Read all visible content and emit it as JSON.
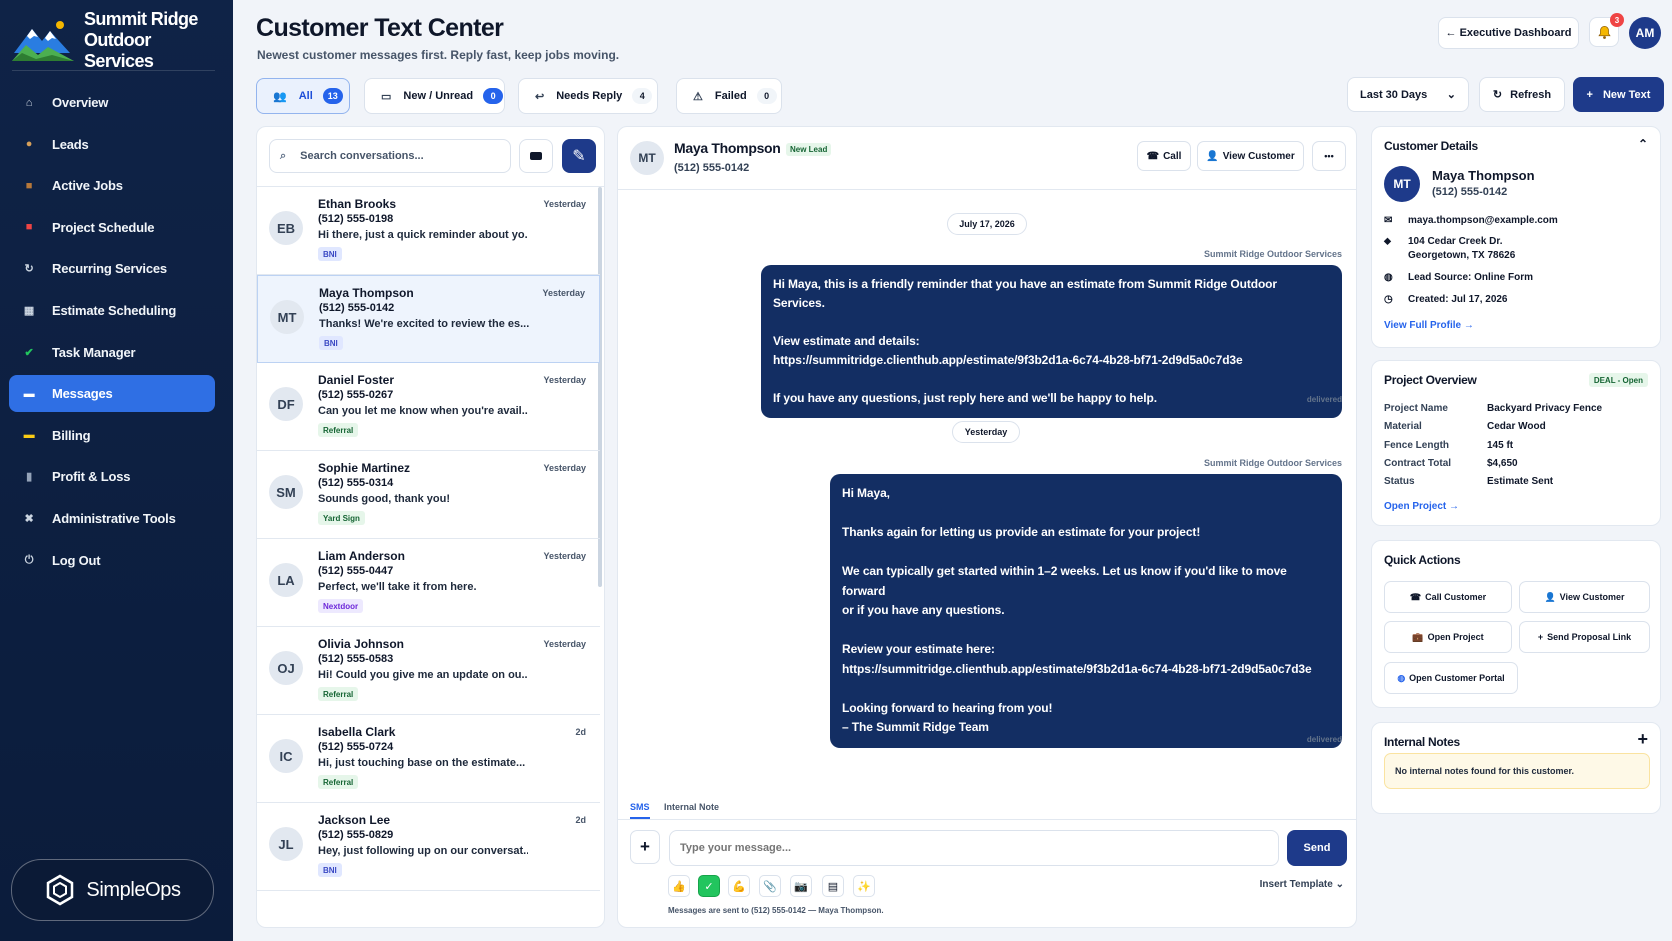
{
  "app": {
    "brand_line1": "Summit Ridge",
    "brand_line2": "Outdoor Services",
    "product": "SimpleOps",
    "accent": "#2f6fe4",
    "navy": "#132e63"
  },
  "sidebar": {
    "items": [
      {
        "label": "Overview",
        "icon": "home-icon"
      },
      {
        "label": "Leads",
        "icon": "users-icon"
      },
      {
        "label": "Active Jobs",
        "icon": "briefcase-icon"
      },
      {
        "label": "Project Schedule",
        "icon": "calendar-icon"
      },
      {
        "label": "Recurring Services",
        "icon": "refresh-icon"
      },
      {
        "label": "Estimate Scheduling",
        "icon": "calculator-icon"
      },
      {
        "label": "Task Manager",
        "icon": "check-icon"
      },
      {
        "label": "Messages",
        "icon": "message-icon",
        "active": true
      },
      {
        "label": "Billing",
        "icon": "card-icon"
      },
      {
        "label": "Profit & Loss",
        "icon": "chart-icon"
      },
      {
        "label": "Administrative Tools",
        "icon": "tools-icon"
      },
      {
        "label": "Log Out",
        "icon": "logout-icon"
      }
    ]
  },
  "header": {
    "title": "Customer Text Center",
    "subtitle": "Newest customer messages first. Reply fast, keep jobs moving.",
    "exec_dashboard": "← Executive Dashboard",
    "notif_count": "3",
    "avatar": "AM",
    "range": "Last 30 Days",
    "refresh": "Refresh",
    "new_text": "New Text"
  },
  "filters": [
    {
      "label": "All",
      "count": "13"
    },
    {
      "label": "New / Unread",
      "count": "0"
    },
    {
      "label": "Needs Reply",
      "count": "4"
    },
    {
      "label": "Failed",
      "count": "0"
    }
  ],
  "search": {
    "placeholder": "Search conversations..."
  },
  "conversations": [
    {
      "initials": "EB",
      "name": "Ethan Brooks",
      "phone": "(512) 555-0198",
      "preview": "Hi there, just a quick reminder about yo...",
      "date": "Yesterday",
      "tag": "BNI"
    },
    {
      "initials": "MT",
      "name": "Maya Thompson",
      "phone": "(512) 555-0142",
      "preview": "Thanks! We're excited to review the es...",
      "date": "Yesterday",
      "tag": "BNI"
    },
    {
      "initials": "DF",
      "name": "Daniel Foster",
      "phone": "(512) 555-0267",
      "preview": "Can you let me know when you're avail...",
      "date": "Yesterday",
      "tag": "Referral"
    },
    {
      "initials": "SM",
      "name": "Sophie Martinez",
      "phone": "(512) 555-0314",
      "preview": "Sounds good, thank you!",
      "date": "Yesterday",
      "tag": "Yard Sign"
    },
    {
      "initials": "LA",
      "name": "Liam Anderson",
      "phone": "(512) 555-0447",
      "preview": "Perfect, we'll take it from here.",
      "date": "Yesterday",
      "tag": "Nextdoor"
    },
    {
      "initials": "OJ",
      "name": "Olivia Johnson",
      "phone": "(512) 555-0583",
      "preview": "Hi! Could you give me an update on ou...",
      "date": "Yesterday",
      "tag": "Referral"
    },
    {
      "initials": "IC",
      "name": "Isabella Clark",
      "phone": "(512) 555-0724",
      "preview": "Hi, just touching base on the estimate...",
      "date": "2d",
      "tag": "Referral"
    },
    {
      "initials": "JL",
      "name": "Jackson Lee",
      "phone": "(512) 555-0829",
      "preview": "Hey, just following up on our conversat...",
      "date": "2d",
      "tag": "BNI"
    }
  ],
  "chat": {
    "initials": "MT",
    "name": "Maya Thompson",
    "badge": "New Lead",
    "phone": "(512) 555-0142",
    "call": "Call",
    "view_customer": "View Customer",
    "more": "•••",
    "date1": "July 17, 2026",
    "sender": "Summit Ridge Outdoor Services",
    "msg1": "Hi Maya, this is a friendly reminder that you have an estimate from Summit Ridge Outdoor Services.\n\nView estimate and details:\nhttps://summitridge.clienthub.app/estimate/9f3b2d1a-6c74-4b28-bf71-2d9d5a0c7d3e\n\nIf you have any questions, just reply here and we'll be happy to help.",
    "status1": "delivered",
    "date2": "Yesterday",
    "msg2": "Hi Maya,\n\nThanks again for letting us provide an estimate for your project!\n\nWe can typically get started within 1–2 weeks. Let us know if you'd like to move forward\nor if you have any questions.\n\nReview your estimate here:\nhttps://summitridge.clienthub.app/estimate/9f3b2d1a-6c74-4b28-bf71-2d9d5a0c7d3e\n\nLooking forward to hearing from you!\n– The Summit Ridge Team",
    "status2": "delivered",
    "tab_sms": "SMS",
    "tab_note": "Internal Note",
    "input_placeholder": "Type your message...",
    "send": "Send",
    "insert_template": "Insert Template",
    "footnote": "Messages are sent to (512) 555-0142 — Maya Thompson."
  },
  "customer": {
    "title": "Customer Details",
    "initials": "MT",
    "name": "Maya Thompson",
    "phone": "(512) 555-0142",
    "email": "maya.thompson@example.com",
    "address1": "104 Cedar Creek Dr.",
    "address2": "Georgetown, TX 78626",
    "lead_source": "Lead Source: Online Form",
    "created": "Created: Jul 17, 2026",
    "view_full": "View Full Profile →"
  },
  "project": {
    "title": "Project Overview",
    "deal": "DEAL - Open",
    "rows": [
      {
        "k": "Project Name",
        "v": "Backyard Privacy Fence"
      },
      {
        "k": "Material",
        "v": "Cedar Wood"
      },
      {
        "k": "Fence Length",
        "v": "145 ft"
      },
      {
        "k": "Contract Total",
        "v": "$4,650"
      },
      {
        "k": "Status",
        "v": "Estimate Sent"
      }
    ],
    "open": "Open Project →"
  },
  "quick": {
    "title": "Quick Actions",
    "call": "Call Customer",
    "view": "View Customer",
    "open_project": "Open Project",
    "proposal": "Send Proposal Link",
    "portal": "Open Customer Portal"
  },
  "notes": {
    "title": "Internal Notes",
    "empty": "No internal notes found for this customer."
  }
}
